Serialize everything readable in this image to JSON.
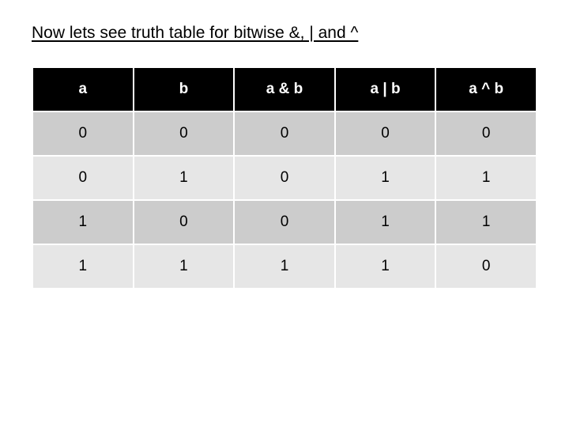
{
  "title": "Now lets see truth table for bitwise &, | and ^",
  "chart_data": {
    "type": "table",
    "headers": [
      "a",
      "b",
      "a & b",
      "a | b",
      "a ^ b"
    ],
    "rows": [
      [
        "0",
        "0",
        "0",
        "0",
        "0"
      ],
      [
        "0",
        "1",
        "0",
        "1",
        "1"
      ],
      [
        "1",
        "0",
        "0",
        "1",
        "1"
      ],
      [
        "1",
        "1",
        "1",
        "1",
        "0"
      ]
    ]
  }
}
